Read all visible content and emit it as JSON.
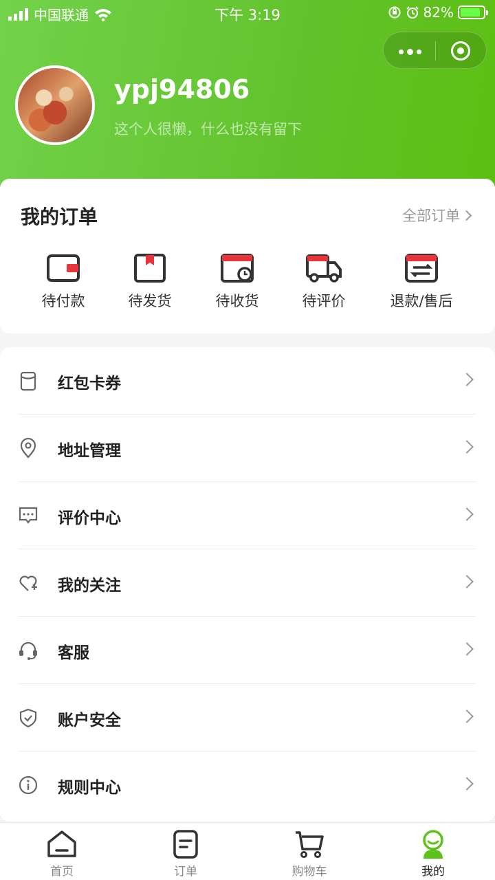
{
  "status_bar": {
    "carrier": "中国联通",
    "time": "下午 3:19",
    "battery": "82%"
  },
  "profile": {
    "username": "ypj94806",
    "bio": "这个人很懒，什么也没有留下"
  },
  "orders": {
    "title": "我的订单",
    "all_label": "全部订单",
    "items": [
      {
        "label": "待付款",
        "icon": "wallet-icon"
      },
      {
        "label": "待发货",
        "icon": "package-icon"
      },
      {
        "label": "待收货",
        "icon": "receive-box-icon"
      },
      {
        "label": "待评价",
        "icon": "truck-icon"
      },
      {
        "label": "退款/售后",
        "icon": "refund-icon"
      }
    ]
  },
  "menu": {
    "items": [
      {
        "label": "红包卡券",
        "icon": "coupon-icon"
      },
      {
        "label": "地址管理",
        "icon": "location-pin-icon"
      },
      {
        "label": "评价中心",
        "icon": "comment-icon"
      },
      {
        "label": "我的关注",
        "icon": "heart-plus-icon"
      },
      {
        "label": "客服",
        "icon": "headset-icon"
      },
      {
        "label": "账户安全",
        "icon": "shield-icon"
      },
      {
        "label": "规则中心",
        "icon": "info-icon"
      }
    ]
  },
  "tabbar": {
    "items": [
      {
        "label": "首页",
        "icon": "home-icon",
        "active": false
      },
      {
        "label": "订单",
        "icon": "order-doc-icon",
        "active": false
      },
      {
        "label": "购物车",
        "icon": "cart-icon",
        "active": false
      },
      {
        "label": "我的",
        "icon": "profile-icon",
        "active": true
      }
    ]
  },
  "colors": {
    "brand_green": "#62c22c",
    "order_icon_red": "#e8343a",
    "active_tab_green": "#5cc21a"
  }
}
